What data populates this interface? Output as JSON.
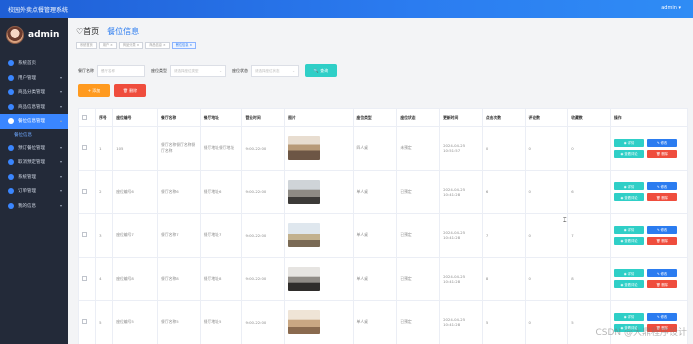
{
  "header": {
    "title": "校园外卖点餐管理系统",
    "user": "admin ▾"
  },
  "sidebar": {
    "username": "admin",
    "items": [
      {
        "label": "系统首页",
        "arrow": ""
      },
      {
        "label": "用户管理",
        "arrow": "▾"
      },
      {
        "label": "商品分类管理",
        "arrow": "▾"
      },
      {
        "label": "商品信息管理",
        "arrow": "▾"
      },
      {
        "label": "餐位信息管理",
        "arrow": "▴"
      },
      {
        "label": "预订餐位管理",
        "arrow": "▾"
      },
      {
        "label": "取消预定管理",
        "arrow": "▾"
      },
      {
        "label": "系统管理",
        "arrow": "▾"
      },
      {
        "label": "订单管理",
        "arrow": "▾"
      },
      {
        "label": "我的信息",
        "arrow": "▾"
      }
    ],
    "active_sub": "餐位信息"
  },
  "page": {
    "icon": "♡",
    "title": "首页",
    "subtitle": "餐位信息",
    "tags": [
      "系统首页",
      "用户 ×",
      "商品分类 ×",
      "商品信息 ×",
      "餐位信息 ×"
    ]
  },
  "filters": {
    "name_label": "餐厅名称",
    "name_placeholder": "餐厅名称",
    "type_label": "座位类型",
    "type_placeholder": "请选择座位类型",
    "status_label": "座位状态",
    "status_placeholder": "请选择座位状态",
    "search": "🔍 查询"
  },
  "actions": {
    "add": "+ 添加",
    "delete": "🗑 删除"
  },
  "table": {
    "headers": [
      "",
      "序号",
      "座位编号",
      "餐厅名称",
      "餐厅地址",
      "营业时间",
      "图片",
      "座位类型",
      "座位状态",
      "更新时间",
      "点击次数",
      "评论数",
      "收藏数",
      "操作"
    ],
    "rows": [
      {
        "no": "1",
        "code": "105",
        "name": "餐厅名称餐厅名称餐厅名称",
        "addr": "餐厅地址餐厅地址",
        "hours": "9:00-22:00",
        "seat_type": "四人桌",
        "status": "未预定",
        "time": "2024-04-25 10:51:57",
        "clicks": "0",
        "comments": "0",
        "favs": "0"
      },
      {
        "no": "2",
        "code": "座位编号6",
        "name": "餐厅名称6",
        "addr": "餐厅地址6",
        "hours": "9:00-22:00",
        "seat_type": "单人桌",
        "status": "已预定",
        "time": "2024-04-25 10:41:28",
        "clicks": "6",
        "comments": "0",
        "favs": "6"
      },
      {
        "no": "3",
        "code": "座位编号7",
        "name": "餐厅名称7",
        "addr": "餐厅地址7",
        "hours": "9:00-22:00",
        "seat_type": "单人桌",
        "status": "已预定",
        "time": "2024-04-25 10:41:28",
        "clicks": "7",
        "comments": "0",
        "favs": "7"
      },
      {
        "no": "4",
        "code": "座位编号8",
        "name": "餐厅名称8",
        "addr": "餐厅地址8",
        "hours": "9:00-22:00",
        "seat_type": "单人桌",
        "status": "已预定",
        "time": "2024-04-25 10:41:28",
        "clicks": "8",
        "comments": "0",
        "favs": "8"
      },
      {
        "no": "5",
        "code": "座位编号5",
        "name": "餐厅名称5",
        "addr": "餐厅地址5",
        "hours": "9:00-22:00",
        "seat_type": "单人桌",
        "status": "已预定",
        "time": "2024-04-25 10:41:28",
        "clicks": "5",
        "comments": "0",
        "favs": "5"
      }
    ],
    "ops": {
      "detail": "◉ 详情",
      "edit": "✎ 修改",
      "review": "◉ 查看评论",
      "delete": "🗑 删除"
    }
  },
  "watermark": "CSDN @大鼎程序设计",
  "colors": {
    "topbar": "#2b7cf0",
    "sidebar": "#232a39",
    "accent": "#3a86ff",
    "cyan": "#2fcfc7",
    "orange": "#ff9a1f",
    "red": "#ef4d3d"
  }
}
